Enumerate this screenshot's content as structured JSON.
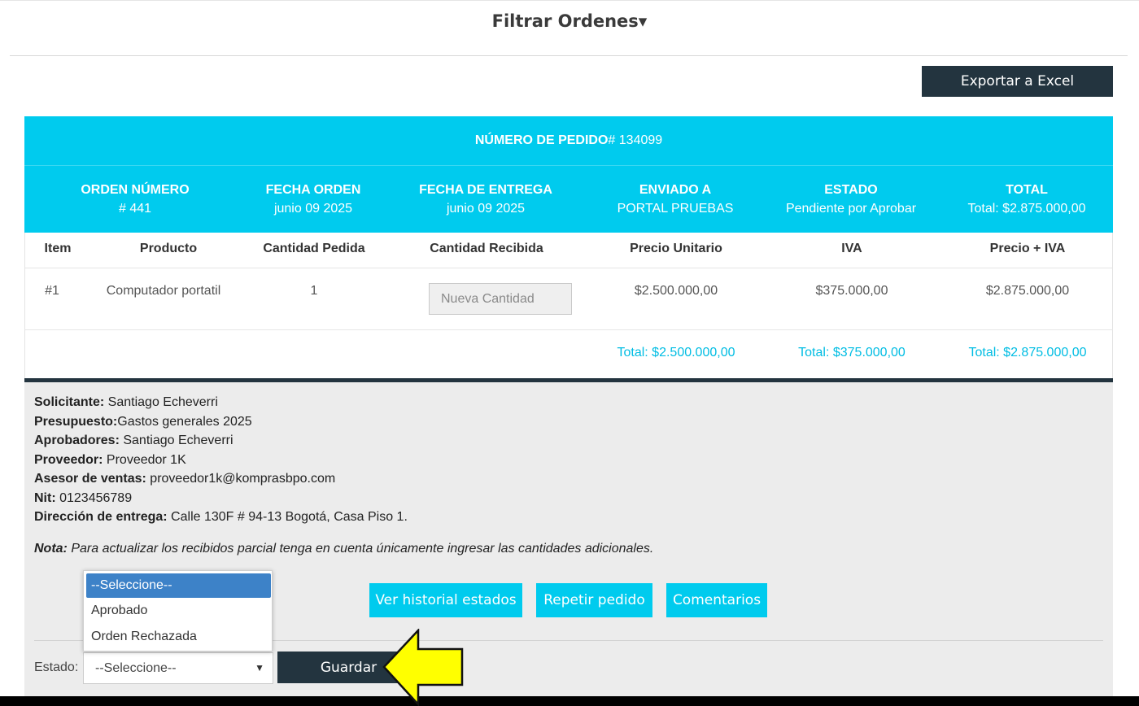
{
  "header": {
    "title": "Filtrar Ordenes",
    "caret": "▾"
  },
  "export_label": "Exportar a Excel",
  "order": {
    "pedido_label": "NÚMERO DE PEDIDO",
    "pedido_value": "# 134099",
    "info": [
      {
        "label": "ORDEN NÚMERO",
        "value": "# 441"
      },
      {
        "label": "FECHA ORDEN",
        "value": "junio 09 2025"
      },
      {
        "label": "FECHA DE ENTREGA",
        "value": "junio 09 2025"
      },
      {
        "label": "ENVIADO A",
        "value": "PORTAL PRUEBAS"
      },
      {
        "label": "ESTADO",
        "value": "Pendiente por Aprobar"
      },
      {
        "label": "TOTAL",
        "value": "Total: $2.875.000,00"
      }
    ]
  },
  "table": {
    "headers": [
      "Item",
      "Producto",
      "Cantidad Pedida",
      "Cantidad Recibida",
      "Precio Unitario",
      "IVA",
      "Precio + IVA"
    ],
    "row": {
      "item": "#1",
      "producto": "Computador portatil",
      "cantidad": "1",
      "cantidad_placeholder": "Nueva Cantidad",
      "precio": "$2.500.000,00",
      "iva": "$375.000,00",
      "precio_iva": "$2.875.000,00"
    },
    "totals": {
      "precio": "Total: $2.500.000,00",
      "iva": "Total: $375.000,00",
      "precio_iva": "Total: $2.875.000,00"
    }
  },
  "details": {
    "solicitante_label": "Solicitante:",
    "solicitante": " Santiago Echeverri",
    "presupuesto_label": "Presupuesto:",
    "presupuesto": "Gastos generales 2025",
    "aprobadores_label": "Aprobadores:",
    "aprobadores": " Santiago Echeverri",
    "proveedor_label": "Proveedor:",
    "proveedor": " Proveedor 1K",
    "asesor_label": "Asesor de ventas:",
    "asesor": " proveedor1k@komprasbpo.com",
    "nit_label": "Nit:",
    "nit": " 0123456789",
    "direccion_label": "Dirección de entrega:",
    "direccion": " Calle 130F # 94-13 Bogotá, Casa Piso 1.",
    "nota_label": "Nota:",
    "nota": " Para actualizar los recibidos parcial tenga en cuenta únicamente ingresar las cantidades adicionales."
  },
  "actions": {
    "historial": "Ver historial estados",
    "repetir": "Repetir pedido",
    "comentarios": "Comentarios"
  },
  "estado": {
    "label": "Estado:",
    "selected": "--Seleccione--",
    "options": [
      "--Seleccione--",
      "Aprobado",
      "Orden Rechazada"
    ],
    "save": "Guardar"
  },
  "colors": {
    "accent": "#00cbee",
    "dark": "#23343f",
    "highlight_arrow": "#ffff00"
  },
  "icons": {
    "arrow": "left-pointing-arrow-icon",
    "caret": "chevron-down-icon"
  }
}
